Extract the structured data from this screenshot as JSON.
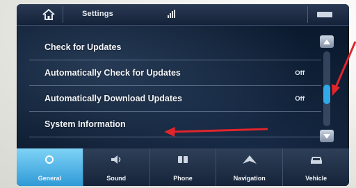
{
  "header": {
    "title": "Settings"
  },
  "list": {
    "items": [
      {
        "label": "Check for Updates",
        "value": ""
      },
      {
        "label": "Automatically Check for Updates",
        "value": "Off"
      },
      {
        "label": "Automatically Download Updates",
        "value": "Off"
      },
      {
        "label": "System Information",
        "value": ""
      }
    ]
  },
  "scrollbar": {
    "position_fraction": 0.6
  },
  "nav": {
    "items": [
      {
        "label": "General",
        "icon": "gear-icon",
        "active": true
      },
      {
        "label": "Sound",
        "icon": "speaker-icon",
        "active": false
      },
      {
        "label": "Phone",
        "icon": "phone-icon",
        "active": false
      },
      {
        "label": "Navigation",
        "icon": "map-icon",
        "active": false
      },
      {
        "label": "Vehicle",
        "icon": "car-icon",
        "active": false
      }
    ]
  },
  "colors": {
    "accent": "#31a8e8",
    "annotation": "#e1252b"
  }
}
